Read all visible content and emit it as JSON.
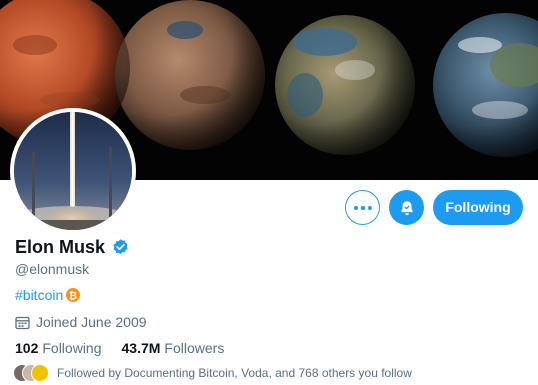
{
  "profile": {
    "name": "Elon Musk",
    "handle": "@elonmusk",
    "bio_hashtag": "#bitcoin",
    "joined": "Joined June 2009",
    "stats": {
      "following_count": "102",
      "following_label": "Following",
      "followers_count": "43.7M",
      "followers_label": "Followers"
    },
    "followed_by": "Followed by Documenting Bitcoin, Voda, and 768 others you follow"
  },
  "actions": {
    "following_label": "Following"
  },
  "icons": {
    "more": "more-options-icon",
    "bell": "notification-bell-icon",
    "verified": "verified-badge-icon",
    "bitcoin": "bitcoin-icon",
    "calendar": "calendar-icon"
  },
  "colors": {
    "accent": "#1d9bf0",
    "text": "#0f1419",
    "secondary_text": "#5b7083",
    "bitcoin": "#f7931a"
  }
}
